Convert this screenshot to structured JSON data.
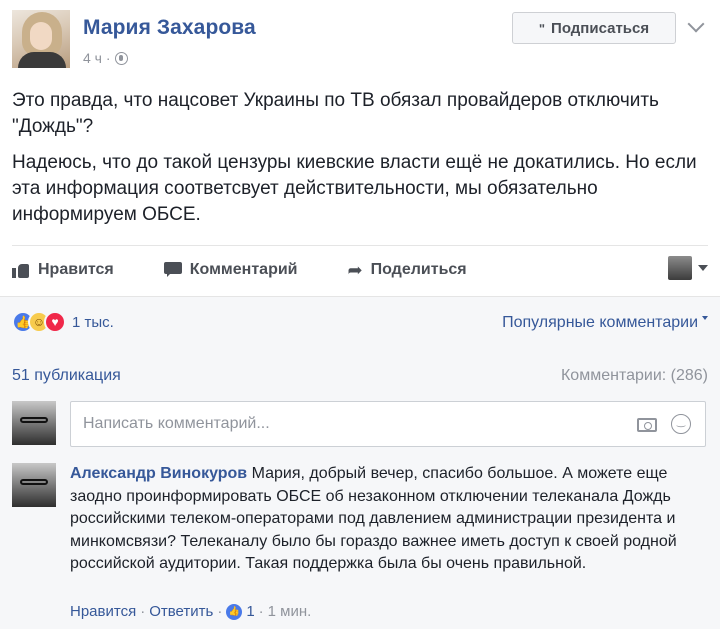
{
  "post": {
    "author": "Мария Захарова",
    "time": "4 ч ·",
    "subscribe_label": "Подписаться",
    "paragraph1": "Это правда, что нацсовет Украины по ТВ обязал провайдеров отключить \"Дождь\"?",
    "paragraph2": "Надеюсь, что до такой цензуры киевские власти ещё не докатились. Но если эта информация соответсвует действительности, мы обязательно информируем ОБСЕ."
  },
  "actions": {
    "like": "Нравится",
    "comment": "Комментарий",
    "share": "Поделиться"
  },
  "feedback": {
    "reactions_count": "1 тыс.",
    "sort_label": "Популярные комментарии",
    "shares": "51 публикация",
    "comments_count": "Комментарии: (286)",
    "composer_placeholder": "Написать комментарий..."
  },
  "comment": {
    "author": "Александр Винокуров",
    "text": " Мария, добрый вечер, спасибо большое. А можете еще заодно проинформировать ОБСЕ об незаконном отключении телеканала Дождь российскими телеком-операторами под давлением администрации президента и минкомсвязи? Телеканалу было бы гораздо важнее иметь доступ к своей родной российской аудитории. Такая поддержка была бы очень правильной.",
    "like": "Нравится",
    "reply": "Ответить",
    "like_count": "1",
    "time": "1 мин."
  },
  "colors": {
    "link": "#365899",
    "meta": "#90949c",
    "like_reaction": "#4a7ae9",
    "love_reaction": "#f0284a",
    "haha_reaction": "#f7cb4d"
  }
}
